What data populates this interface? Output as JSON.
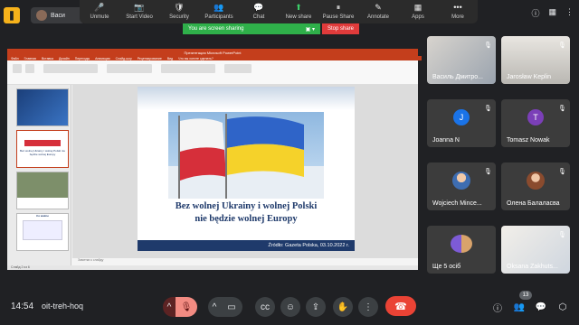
{
  "top": {
    "chip_name": "Васи",
    "zoom_buttons": [
      {
        "label": "Unmute",
        "icon": "mic-off-icon",
        "glyph": "🎤"
      },
      {
        "label": "Start Video",
        "icon": "video-off-icon",
        "glyph": "📷"
      },
      {
        "label": "Security",
        "icon": "shield-icon",
        "glyph": "🛡"
      },
      {
        "label": "Participants",
        "icon": "participants-icon",
        "glyph": "👥"
      },
      {
        "label": "Chat",
        "icon": "chat-icon",
        "glyph": "💬"
      },
      {
        "label": "New share",
        "icon": "share-icon",
        "glyph": "⬆"
      },
      {
        "label": "Pause Share",
        "icon": "pause-icon",
        "glyph": "⏸"
      },
      {
        "label": "Annotate",
        "icon": "annotate-icon",
        "glyph": "✎"
      },
      {
        "label": "Apps",
        "icon": "apps-icon",
        "glyph": "▦"
      },
      {
        "label": "More",
        "icon": "more-icon",
        "glyph": "•••"
      }
    ],
    "sharing_message": "You are screen sharing",
    "stop_share_label": "Stop share"
  },
  "ppt": {
    "window_title": "Презентация Microsoft PowerPoint",
    "tabs": [
      "Файл",
      "Главная",
      "Вставка",
      "Дизайн",
      "Переходы",
      "Анимация",
      "Слайд-шоу",
      "Рецензирование",
      "Вид",
      "Что вы хотите сделать?"
    ],
    "thumbnails": [
      {
        "caption": ""
      },
      {
        "caption": "Bez wolnej Ukrainy i wolnej Polski nie będzie wolnej Europy"
      },
      {
        "caption": ""
      },
      {
        "caption": "Co ważne"
      }
    ],
    "slide": {
      "heading_line1": "Bez wolnej Ukrainy i wolnej Polski",
      "heading_line2": "nie będzie wolnej Europy",
      "source": "Źródło: Gazeta Polska, 03.10.2022 r."
    },
    "notes_placeholder": "Заметки к слайду",
    "status": "Слайд 2 из 6"
  },
  "participants": [
    {
      "name": "Василь Дмитро...",
      "type": "video",
      "muted": true
    },
    {
      "name": "Jarosław Keplin",
      "type": "video",
      "muted": true
    },
    {
      "name": "Joanna N",
      "type": "letter",
      "letter": "J",
      "color": "#1a73e8",
      "muted": true
    },
    {
      "name": "Tomasz Nowak",
      "type": "letter",
      "letter": "T",
      "color": "#7b3fb8",
      "muted": true
    },
    {
      "name": "Wojciech Mince...",
      "type": "photo",
      "muted": true
    },
    {
      "name": "Олена Балаласва",
      "type": "photo",
      "muted": true
    },
    {
      "name": "Ще 5 осіб",
      "type": "group",
      "muted": false
    },
    {
      "name": "Oksana Zakhuts...",
      "type": "video",
      "muted": true
    }
  ],
  "bottom": {
    "time": "14:54",
    "meeting_code": "oit-treh-hoq",
    "people_count": "13"
  },
  "colors": {
    "accent_green": "#2fb04a",
    "stop_red": "#e03b3b",
    "end_call": "#ea4335"
  }
}
